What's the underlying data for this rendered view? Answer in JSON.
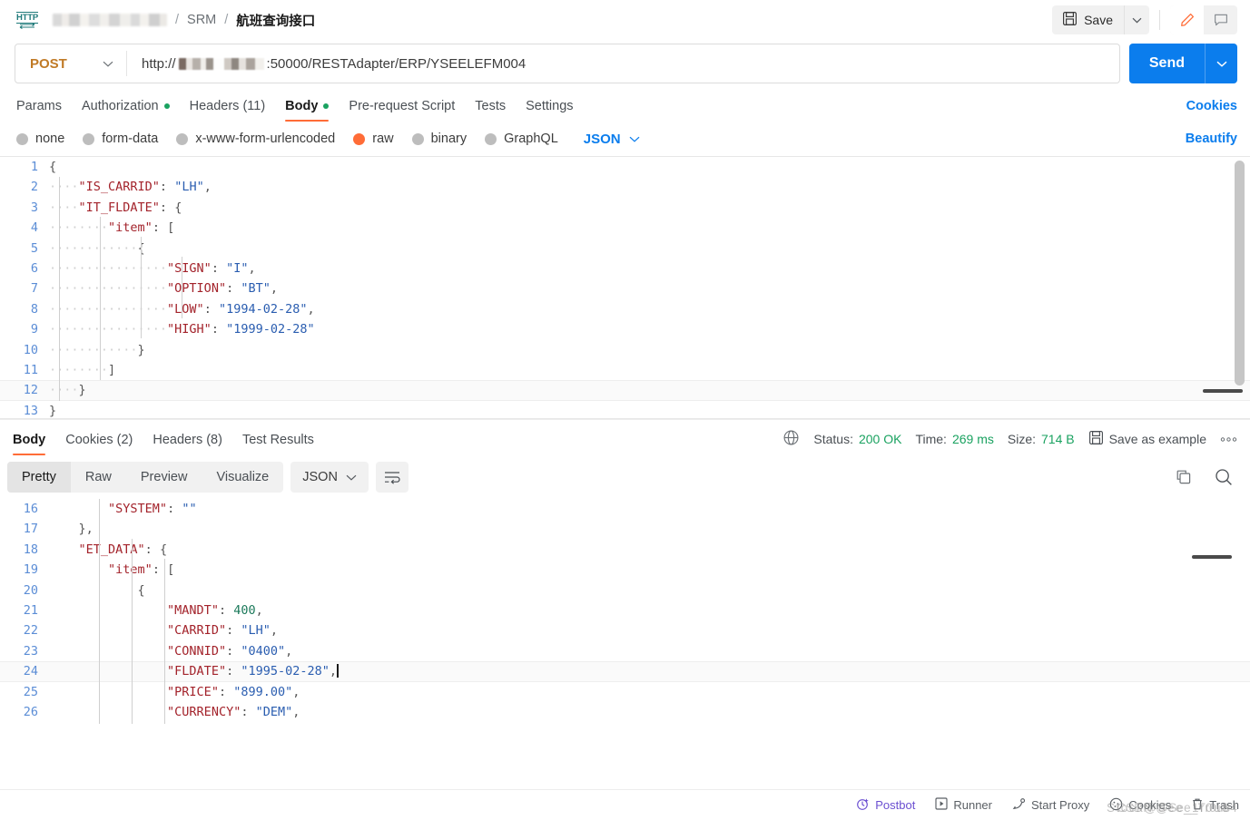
{
  "breadcrumb": {
    "icon": "http-icon",
    "workspace_redacted": "",
    "sep": "/",
    "collection": "SRM",
    "current": "航班查询接口"
  },
  "toolbar": {
    "save_label": "Save",
    "save_icon": "floppy-disk-icon",
    "caret_icon": "chevron-down-icon",
    "edit_icon": "pencil-icon",
    "comment_icon": "comment-icon"
  },
  "url_row": {
    "method": "POST",
    "method_caret": "chevron-down-icon",
    "url_prefix": "http://",
    "url_suffix": ":50000/RESTAdapter/ERP/YSEELEFM004",
    "send_label": "Send",
    "send_caret": "chevron-down-icon"
  },
  "request_tabs": {
    "items": [
      {
        "label": "Params",
        "active": false,
        "badge": "",
        "dot": false
      },
      {
        "label": "Authorization",
        "active": false,
        "badge": "",
        "dot": true
      },
      {
        "label": "Headers (11)",
        "active": false,
        "badge": "",
        "dot": false
      },
      {
        "label": "Body",
        "active": true,
        "badge": "",
        "dot": true
      },
      {
        "label": "Pre-request Script",
        "active": false,
        "badge": "",
        "dot": false
      },
      {
        "label": "Tests",
        "active": false,
        "badge": "",
        "dot": false
      },
      {
        "label": "Settings",
        "active": false,
        "badge": "",
        "dot": false
      }
    ],
    "cookies_link": "Cookies"
  },
  "body_options": {
    "radios": [
      {
        "label": "none",
        "selected": false
      },
      {
        "label": "form-data",
        "selected": false
      },
      {
        "label": "x-www-form-urlencoded",
        "selected": false
      },
      {
        "label": "raw",
        "selected": true
      },
      {
        "label": "binary",
        "selected": false
      },
      {
        "label": "GraphQL",
        "selected": false
      }
    ],
    "format": "JSON",
    "format_caret": "chevron-down-icon",
    "beautify": "Beautify"
  },
  "request_body": {
    "lines": [
      {
        "n": "1",
        "text": "{"
      },
      {
        "n": "2",
        "text": "    \"IS_CARRID\": \"LH\","
      },
      {
        "n": "3",
        "text": "    \"IT_FLDATE\": {"
      },
      {
        "n": "4",
        "text": "        \"item\": ["
      },
      {
        "n": "5",
        "text": "            {"
      },
      {
        "n": "6",
        "text": "                \"SIGN\": \"I\","
      },
      {
        "n": "7",
        "text": "                \"OPTION\": \"BT\","
      },
      {
        "n": "8",
        "text": "                \"LOW\": \"1994-02-28\","
      },
      {
        "n": "9",
        "text": "                \"HIGH\": \"1999-02-28\""
      },
      {
        "n": "10",
        "text": "            }"
      },
      {
        "n": "11",
        "text": "        ]"
      },
      {
        "n": "12",
        "text": "    }"
      },
      {
        "n": "13",
        "text": "}"
      }
    ]
  },
  "response_tabs": {
    "items": [
      {
        "label": "Body",
        "active": true
      },
      {
        "label": "Cookies (2)",
        "active": false
      },
      {
        "label": "Headers (8)",
        "active": false
      },
      {
        "label": "Test Results",
        "active": false
      }
    ],
    "globe_icon": "globe-icon",
    "status_label": "Status:",
    "status_value": "200 OK",
    "time_label": "Time:",
    "time_value": "269 ms",
    "size_label": "Size:",
    "size_value": "714 B",
    "save_example_icon": "floppy-disk-icon",
    "save_example": "Save as example",
    "more_icon": "ellipsis-icon"
  },
  "response_tools": {
    "views": [
      {
        "label": "Pretty",
        "active": true
      },
      {
        "label": "Raw",
        "active": false
      },
      {
        "label": "Preview",
        "active": false
      },
      {
        "label": "Visualize",
        "active": false
      }
    ],
    "format": "JSON",
    "format_caret": "chevron-down-icon",
    "wrap_icon": "word-wrap-icon",
    "copy_icon": "copy-icon",
    "search_icon": "search-icon"
  },
  "response_body": {
    "lines": [
      {
        "n": "16",
        "text": "        \"SYSTEM\": \"\""
      },
      {
        "n": "17",
        "text": "    },"
      },
      {
        "n": "18",
        "text": "    \"ET_DATA\": {"
      },
      {
        "n": "19",
        "text": "        \"item\": ["
      },
      {
        "n": "20",
        "text": "            {"
      },
      {
        "n": "21",
        "text": "                \"MANDT\": 400,"
      },
      {
        "n": "22",
        "text": "                \"CARRID\": \"LH\","
      },
      {
        "n": "23",
        "text": "                \"CONNID\": \"0400\","
      },
      {
        "n": "24",
        "text": "                \"FLDATE\": \"1995-02-28\","
      },
      {
        "n": "25",
        "text": "                \"PRICE\": \"899.00\","
      },
      {
        "n": "26",
        "text": "                \"CURRENCY\": \"DEM\","
      }
    ]
  },
  "statusbar": {
    "postbot": "Postbot",
    "postbot_icon": "postbot-icon",
    "runner": "Runner",
    "runner_icon": "play-icon",
    "start_proxy": "Start Proxy",
    "proxy_icon": "proxy-icon",
    "cookies": "Cookies",
    "cookies_icon": "cookie-icon",
    "trash": "Trash",
    "trash_icon": "trash-icon",
    "watermark": "CSDN @See_Tr0ub4",
    "watermark_alt": "Stock@See_1r0u8"
  },
  "colors": {
    "accent": "#ff6c37",
    "link": "#0b7ded",
    "success": "#1aa260",
    "method": "#c07a26"
  }
}
